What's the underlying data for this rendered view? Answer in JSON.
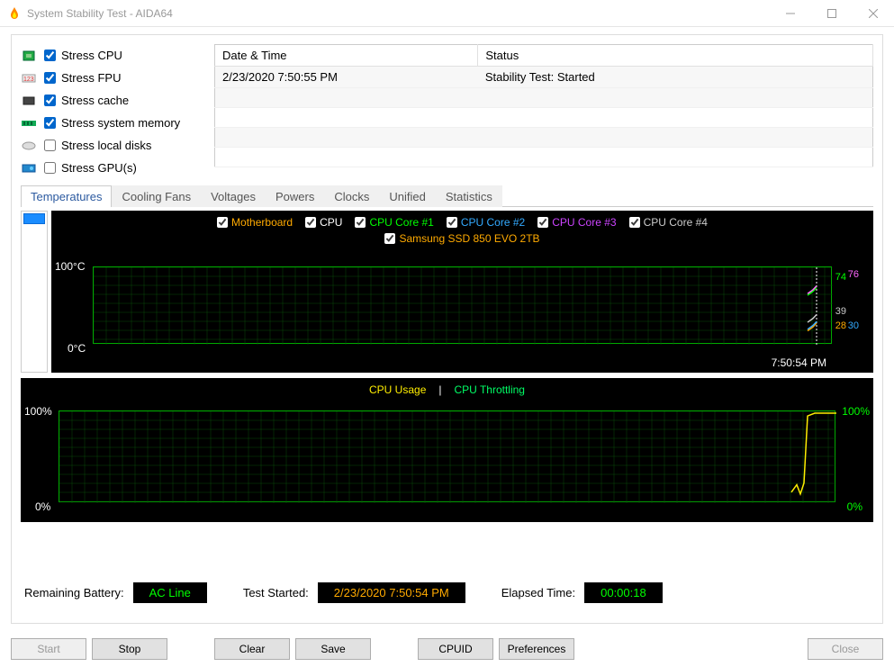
{
  "window": {
    "title": "System Stability Test - AIDA64"
  },
  "stress_options": [
    {
      "label": "Stress CPU",
      "checked": true,
      "icon": "cpu"
    },
    {
      "label": "Stress FPU",
      "checked": true,
      "icon": "fpu"
    },
    {
      "label": "Stress cache",
      "checked": true,
      "icon": "cache"
    },
    {
      "label": "Stress system memory",
      "checked": true,
      "icon": "ram"
    },
    {
      "label": "Stress local disks",
      "checked": false,
      "icon": "disk"
    },
    {
      "label": "Stress GPU(s)",
      "checked": false,
      "icon": "gpu"
    }
  ],
  "log": {
    "headers": [
      "Date & Time",
      "Status"
    ],
    "rows": [
      {
        "datetime": "2/23/2020 7:50:55 PM",
        "status": "Stability Test: Started"
      }
    ]
  },
  "tabs": [
    "Temperatures",
    "Cooling Fans",
    "Voltages",
    "Powers",
    "Clocks",
    "Unified",
    "Statistics"
  ],
  "active_tab": 0,
  "temp_chart": {
    "legend": [
      {
        "label": "Motherboard",
        "color": "#ffaa00",
        "checked": true
      },
      {
        "label": "CPU",
        "color": "#ffffff",
        "checked": true
      },
      {
        "label": "CPU Core #1",
        "color": "#00ff00",
        "checked": true
      },
      {
        "label": "CPU Core #2",
        "color": "#33aaff",
        "checked": true
      },
      {
        "label": "CPU Core #3",
        "color": "#cc44ff",
        "checked": true
      },
      {
        "label": "CPU Core #4",
        "color": "#cccccc",
        "checked": true
      },
      {
        "label": "Samsung SSD 850 EVO 2TB",
        "color": "#ffaa00",
        "checked": true
      }
    ],
    "y_max": "100°C",
    "y_min": "0°C",
    "time_label": "7:50:54 PM",
    "edge_readouts": [
      {
        "text": "74",
        "color": "#00ff00",
        "top": 38
      },
      {
        "text": "76",
        "color": "#ff66ff",
        "top": 36,
        "left_offset": 14
      },
      {
        "text": "39",
        "color": "#cccccc",
        "top": 59
      },
      {
        "text": "28",
        "color": "#ffaa00",
        "top": 68
      },
      {
        "text": "30",
        "color": "#33aaff",
        "top": 68,
        "left_offset": 14
      }
    ]
  },
  "cpu_chart": {
    "legend": [
      {
        "label": "CPU Usage",
        "color": "#ffee00"
      },
      {
        "label": "CPU Throttling",
        "color": "#00ff66"
      }
    ],
    "separator": "|",
    "y_max": "100%",
    "y_min": "0%",
    "right_max": "100%",
    "right_min": "0%"
  },
  "status": {
    "battery_label": "Remaining Battery:",
    "battery_value": "AC Line",
    "started_label": "Test Started:",
    "started_value": "2/23/2020 7:50:54 PM",
    "elapsed_label": "Elapsed Time:",
    "elapsed_value": "00:00:18"
  },
  "buttons": {
    "start": "Start",
    "stop": "Stop",
    "clear": "Clear",
    "save": "Save",
    "cpuid": "CPUID",
    "preferences": "Preferences",
    "close": "Close"
  },
  "chart_data": [
    {
      "type": "line",
      "title": "Temperatures",
      "ylabel": "°C",
      "ylim": [
        0,
        100
      ],
      "x_time_label": "7:50:54 PM",
      "series": [
        {
          "name": "Motherboard",
          "latest_value": 28
        },
        {
          "name": "CPU",
          "latest_value": 39
        },
        {
          "name": "CPU Core #1",
          "latest_value": 74
        },
        {
          "name": "CPU Core #2",
          "latest_value": 30
        },
        {
          "name": "CPU Core #3",
          "latest_value": 76
        },
        {
          "name": "CPU Core #4",
          "latest_value": 74
        },
        {
          "name": "Samsung SSD 850 EVO 2TB",
          "latest_value": 28
        }
      ]
    },
    {
      "type": "line",
      "title": "CPU",
      "ylabel": "%",
      "ylim": [
        0,
        100
      ],
      "series": [
        {
          "name": "CPU Usage",
          "latest_value": 100
        },
        {
          "name": "CPU Throttling",
          "latest_value": 0
        }
      ]
    }
  ]
}
